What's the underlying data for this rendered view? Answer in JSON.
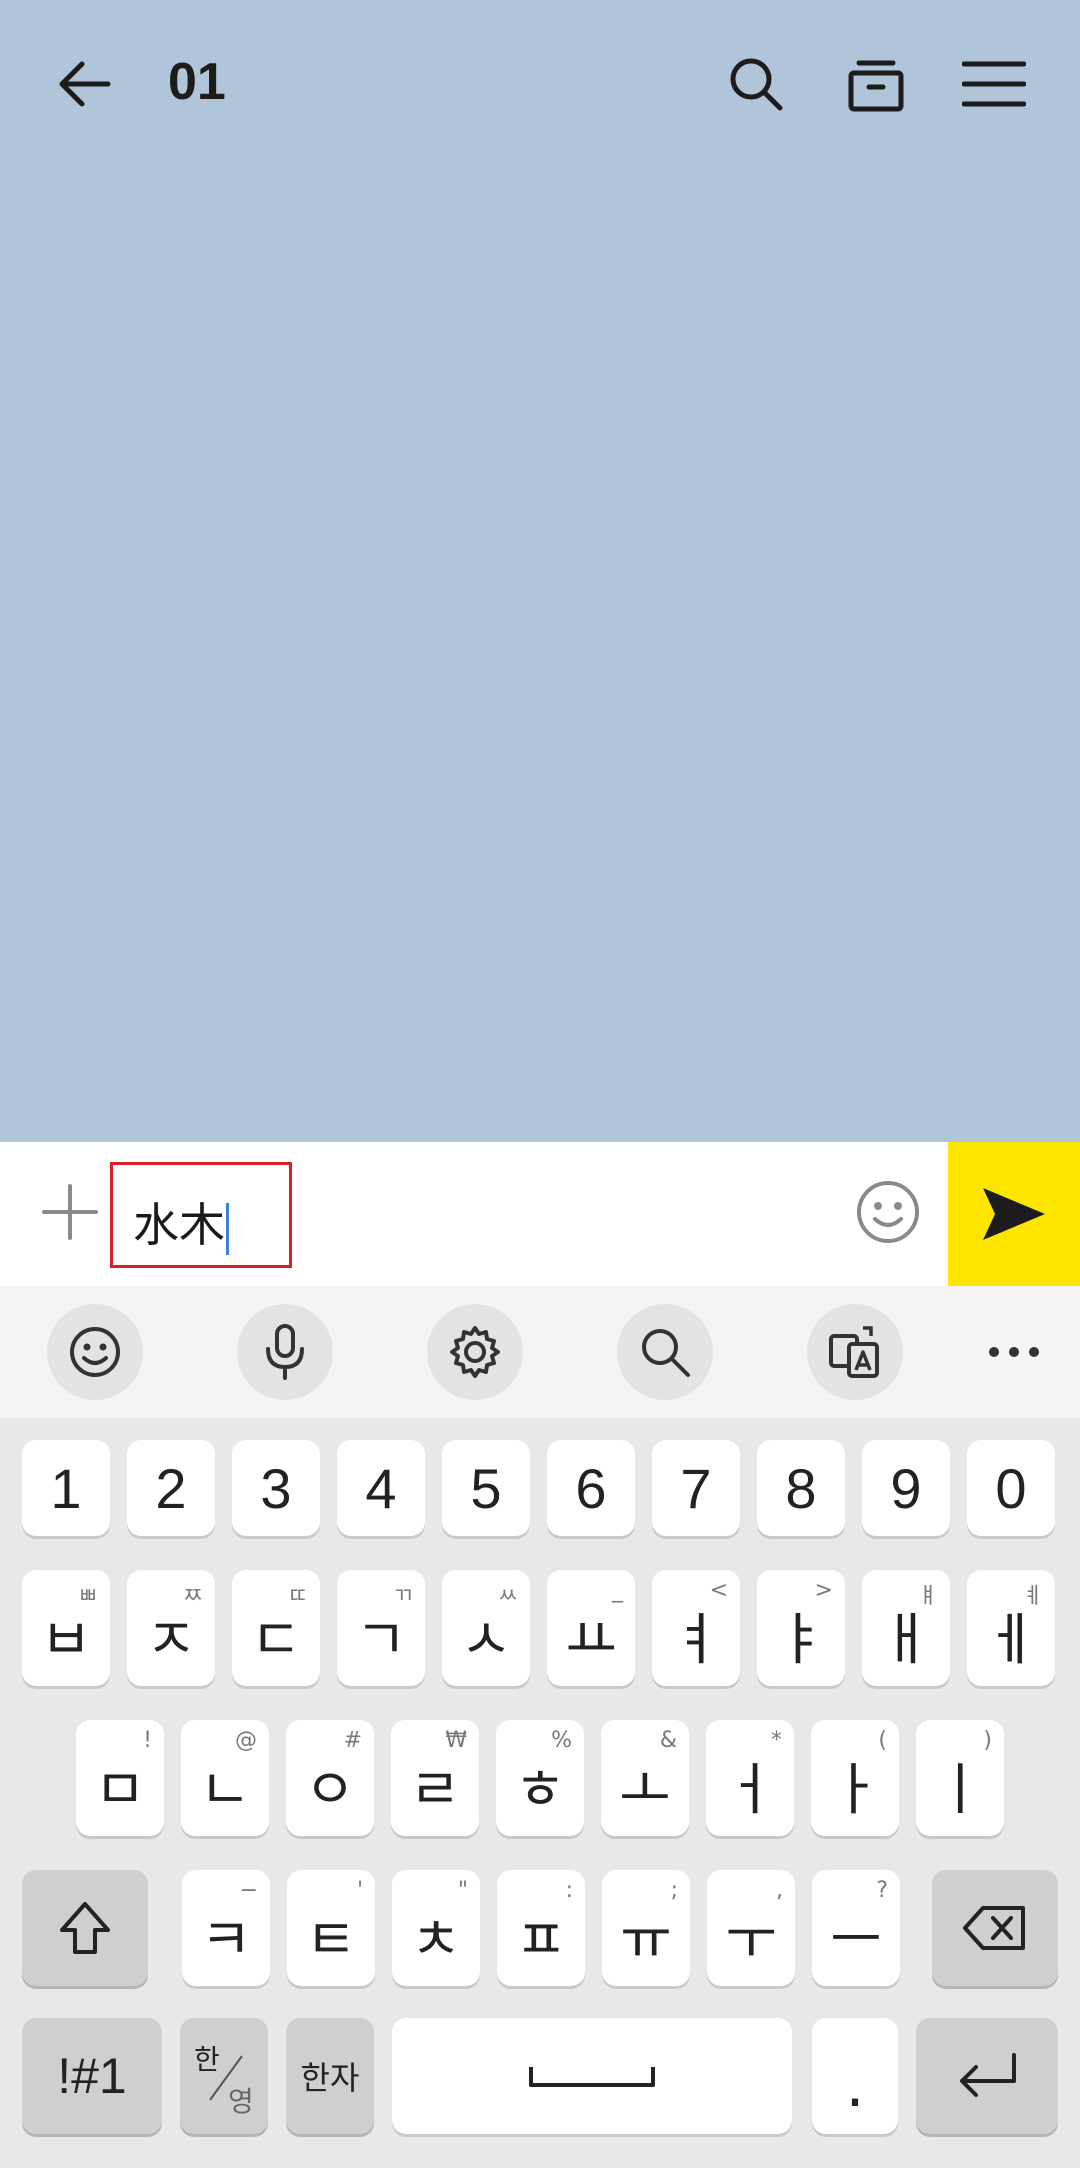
{
  "header": {
    "title": "01",
    "icons": [
      "back-arrow-icon",
      "search-icon",
      "archive-icon",
      "menu-icon"
    ]
  },
  "input": {
    "text": "水木",
    "icons": [
      "plus-icon",
      "emoji-icon",
      "send-icon"
    ]
  },
  "keyboard_toolbar": {
    "icons": [
      "emoji-icon",
      "microphone-icon",
      "settings-icon",
      "search-icon",
      "translate-icon",
      "more-icon"
    ]
  },
  "keyboard": {
    "numbers": [
      "1",
      "2",
      "3",
      "4",
      "5",
      "6",
      "7",
      "8",
      "9",
      "0"
    ],
    "row1": [
      {
        "main": "ㅂ",
        "sub": "ㅃ"
      },
      {
        "main": "ㅈ",
        "sub": "ㅉ"
      },
      {
        "main": "ㄷ",
        "sub": "ㄸ"
      },
      {
        "main": "ㄱ",
        "sub": "ㄲ"
      },
      {
        "main": "ㅅ",
        "sub": "ㅆ"
      },
      {
        "main": "ㅛ",
        "sub": "_"
      },
      {
        "main": "ㅕ",
        "sub": "<"
      },
      {
        "main": "ㅑ",
        "sub": ">"
      },
      {
        "main": "ㅐ",
        "sub": "ㅒ"
      },
      {
        "main": "ㅔ",
        "sub": "ㅖ"
      }
    ],
    "row2": [
      {
        "main": "ㅁ",
        "sub": "!"
      },
      {
        "main": "ㄴ",
        "sub": "@"
      },
      {
        "main": "ㅇ",
        "sub": "#"
      },
      {
        "main": "ㄹ",
        "sub": "₩"
      },
      {
        "main": "ㅎ",
        "sub": "%"
      },
      {
        "main": "ㅗ",
        "sub": "&"
      },
      {
        "main": "ㅓ",
        "sub": "*"
      },
      {
        "main": "ㅏ",
        "sub": "("
      },
      {
        "main": "ㅣ",
        "sub": ")"
      }
    ],
    "row3": [
      {
        "main": "ㅋ",
        "sub": "−"
      },
      {
        "main": "ㅌ",
        "sub": "'"
      },
      {
        "main": "ㅊ",
        "sub": "\""
      },
      {
        "main": "ㅍ",
        "sub": ":"
      },
      {
        "main": "ㅠ",
        "sub": ";"
      },
      {
        "main": "ㅜ",
        "sub": ","
      },
      {
        "main": "ㅡ",
        "sub": "?"
      }
    ],
    "symbols_label": "!#1",
    "lang_top": "한",
    "lang_bottom": "영",
    "hanja_label": "한자",
    "period_label": "."
  }
}
